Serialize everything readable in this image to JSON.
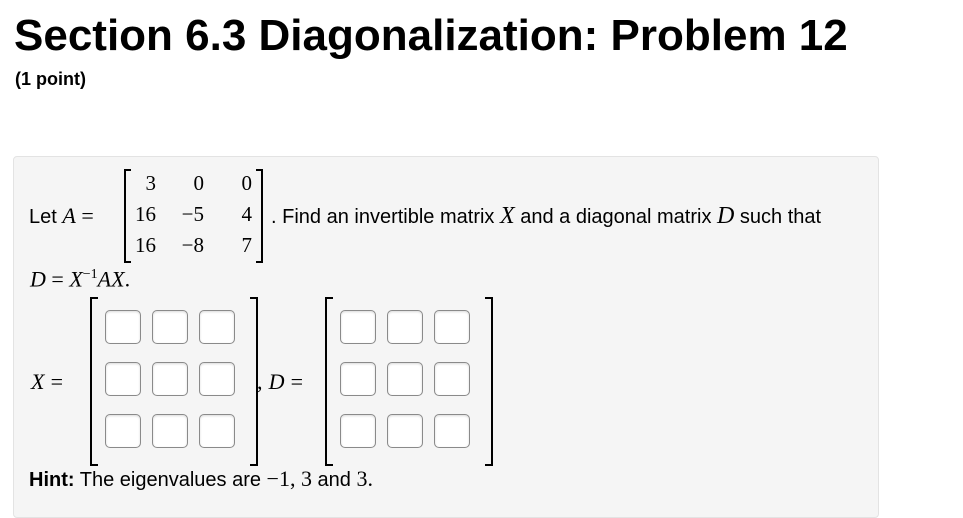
{
  "title": "Section 6.3 Diagonalization: Problem 12",
  "points": "(1 point)",
  "problem": {
    "let_text": "Let",
    "A_label": "A",
    "equals": "=",
    "matrix_A": [
      [
        "3",
        "0",
        "0"
      ],
      [
        "16",
        "−5",
        "4"
      ],
      [
        "16",
        "−8",
        "7"
      ]
    ],
    "find_text": ". Find an invertible matrix",
    "X_label": "X",
    "and_text": "and a diagonal matrix",
    "D_label": "D",
    "such_that": "such that",
    "formula": "D = X−1AX."
  },
  "answer": {
    "X_label": "X",
    "equals": "=",
    "comma": ",",
    "D_label": "D",
    "X_values": [
      [
        "",
        "",
        ""
      ],
      [
        "",
        "",
        ""
      ],
      [
        "",
        "",
        ""
      ]
    ],
    "D_values": [
      [
        "",
        "",
        ""
      ],
      [
        "",
        "",
        ""
      ],
      [
        "",
        "",
        ""
      ]
    ]
  },
  "hint": {
    "label": "Hint:",
    "text": "The eigenvalues are",
    "values": "−1, 3",
    "and_text": "and",
    "last_value": "3."
  }
}
